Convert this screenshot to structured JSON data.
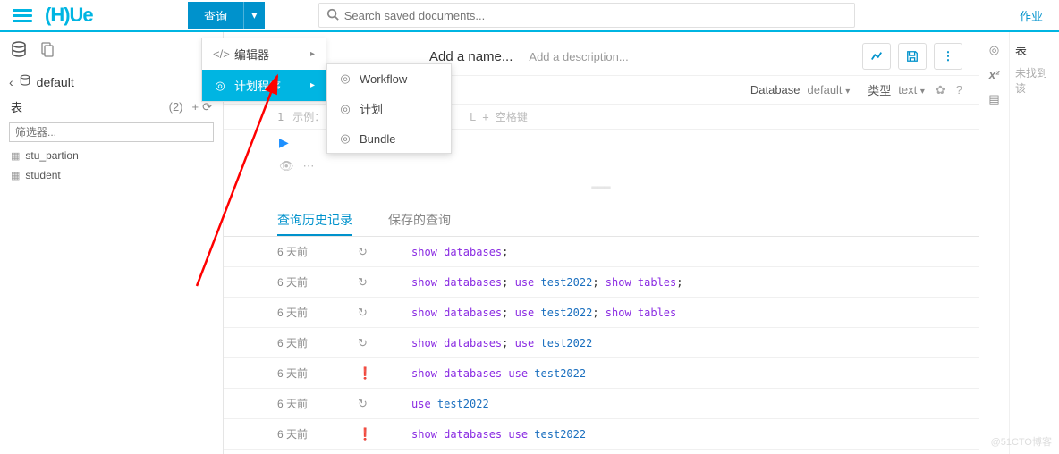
{
  "topbar": {
    "query_label": "查询",
    "search_placeholder": "Search saved documents...",
    "jobs_label": "作业"
  },
  "left": {
    "db_name": "default",
    "tables_label": "表",
    "tables_count": "(2)",
    "filter_placeholder": "筛选器...",
    "tables": [
      "stu_partion",
      "student"
    ]
  },
  "menu1": {
    "editor": "编辑器",
    "scheduler": "计划程序"
  },
  "menu2": {
    "workflow": "Workflow",
    "plan": "计划",
    "bundle": "Bundle"
  },
  "main": {
    "add_name": "Add a name...",
    "add_desc": "Add a description...",
    "db_label": "Database",
    "db_value": "default",
    "type_label": "类型",
    "type_value": "text",
    "editor_hint_prefix": "示例：",
    "editor_hint_sql": "SEL",
    "editor_hint_suffix": "L + 空格键",
    "tabs": {
      "history": "查询历史记录",
      "saved": "保存的查询"
    },
    "history": [
      {
        "time": "6 天前",
        "icon": "refresh",
        "tokens": [
          [
            "kw",
            "show"
          ],
          [
            "fn",
            " databases"
          ],
          [
            "",
            ";"
          ]
        ]
      },
      {
        "time": "6 天前",
        "icon": "refresh",
        "tokens": [
          [
            "kw",
            "show"
          ],
          [
            "fn",
            " databases"
          ],
          [
            "",
            "; "
          ],
          [
            "kw",
            "use"
          ],
          [
            "id",
            " test2022"
          ],
          [
            "",
            "; "
          ],
          [
            "kw",
            "show"
          ],
          [
            "fn",
            " tables"
          ],
          [
            "",
            ";"
          ]
        ]
      },
      {
        "time": "6 天前",
        "icon": "refresh",
        "tokens": [
          [
            "kw",
            "show"
          ],
          [
            "fn",
            " databases"
          ],
          [
            "",
            "; "
          ],
          [
            "kw",
            "use"
          ],
          [
            "id",
            " test2022"
          ],
          [
            "",
            "; "
          ],
          [
            "kw",
            "show"
          ],
          [
            "fn",
            " tables"
          ]
        ]
      },
      {
        "time": "6 天前",
        "icon": "refresh",
        "tokens": [
          [
            "kw",
            "show"
          ],
          [
            "fn",
            " databases"
          ],
          [
            "",
            "; "
          ],
          [
            "kw",
            "use"
          ],
          [
            "id",
            " test2022"
          ]
        ]
      },
      {
        "time": "6 天前",
        "icon": "warn",
        "tokens": [
          [
            "kw",
            "show"
          ],
          [
            "fn",
            " databases "
          ],
          [
            "kw",
            "use"
          ],
          [
            "id",
            " test2022"
          ]
        ]
      },
      {
        "time": "6 天前",
        "icon": "refresh",
        "tokens": [
          [
            "kw",
            "use"
          ],
          [
            "id",
            " test2022"
          ]
        ]
      },
      {
        "time": "6 天前",
        "icon": "warn",
        "tokens": [
          [
            "kw",
            "show"
          ],
          [
            "fn",
            " databases "
          ],
          [
            "kw",
            "use"
          ],
          [
            "id",
            " test2022"
          ]
        ]
      }
    ]
  },
  "right": {
    "header": "表",
    "empty": "未找到该"
  },
  "watermark": "@51CTO博客"
}
